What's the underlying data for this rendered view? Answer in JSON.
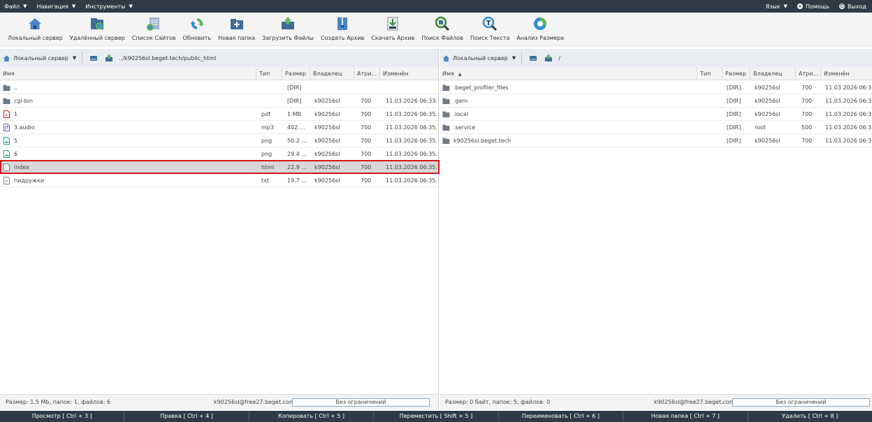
{
  "menu": {
    "file": "Файл",
    "navigation": "Навигация",
    "tools": "Инструменты",
    "language": "Язык",
    "help": "Помощь",
    "logout": "Выход"
  },
  "toolbar": [
    {
      "label": "Локальный сервер",
      "icon": "home-icon"
    },
    {
      "label": "Удалённый сервер",
      "icon": "remote-server-icon"
    },
    {
      "label": "Список Сайтов",
      "icon": "sites-list-icon"
    },
    {
      "label": "Обновить",
      "icon": "refresh-icon"
    },
    {
      "label": "Новая папка",
      "icon": "new-folder-icon"
    },
    {
      "label": "Загрузить Файлы",
      "icon": "upload-icon"
    },
    {
      "label": "Создать Архив",
      "icon": "create-archive-icon"
    },
    {
      "label": "Скачать Архив",
      "icon": "download-archive-icon"
    },
    {
      "label": "Поиск Файлов",
      "icon": "file-search-icon"
    },
    {
      "label": "Поиск Текста",
      "icon": "text-search-icon"
    },
    {
      "label": "Анализ Размера",
      "icon": "size-analysis-icon"
    }
  ],
  "left": {
    "server": "Локальный сервер",
    "path": "../k90256sl.beget.tech/public_html",
    "columns": {
      "name": "Имя",
      "type": "Тип",
      "size": "Размер",
      "owner": "Владелец",
      "attr": "Атри...",
      "modified": "Изменён"
    },
    "rows": [
      {
        "name": "..",
        "type": "",
        "size": "[DIR]",
        "owner": "",
        "attr": "",
        "modified": "",
        "icon": "folder-icon"
      },
      {
        "name": "cgi-bin",
        "type": "",
        "size": "[DIR]",
        "owner": "k90256sl",
        "attr": "700",
        "modified": "11.03.2026 06:33...",
        "icon": "folder-icon"
      },
      {
        "name": "1",
        "type": "pdf",
        "size": "1 MB",
        "owner": "k90256sl",
        "attr": "700",
        "modified": "11.03.2026 06:35...",
        "icon": "pdf-file-icon"
      },
      {
        "name": "3.audio",
        "type": "mp3",
        "size": "402....",
        "owner": "k90256sl",
        "attr": "700",
        "modified": "11.03.2026 06:35...",
        "icon": "audio-file-icon"
      },
      {
        "name": "5",
        "type": "png",
        "size": "50.2 ...",
        "owner": "k90256sl",
        "attr": "700",
        "modified": "11.03.2026 06:35...",
        "icon": "image-file-icon"
      },
      {
        "name": "6",
        "type": "png",
        "size": "29.4 ...",
        "owner": "k90256sl",
        "attr": "700",
        "modified": "11.03.2026 06:35...",
        "icon": "image-file-icon"
      },
      {
        "name": "index",
        "type": "html",
        "size": "22.9 ...",
        "owner": "k90256sl",
        "attr": "700",
        "modified": "11.03.2026 06:35...",
        "icon": "html-file-icon"
      },
      {
        "name": "пидружки",
        "type": "txt",
        "size": "19.7 ...",
        "owner": "k90256sl",
        "attr": "700",
        "modified": "11.03.2026 06:35...",
        "icon": "text-file-icon"
      }
    ],
    "status": "Размер: 1.5 Mb, папок: 1, файлов: 6",
    "user": "k90256sl@free27.beget.com",
    "limit": "Без ограничений"
  },
  "right": {
    "server": "Локальный сервер",
    "path": "/",
    "columns": {
      "name": "Имя",
      "type": "Тип",
      "size": "Размер",
      "owner": "Владелец",
      "attr": "Атри...",
      "modified": "Изменён"
    },
    "rows": [
      {
        "name": ".beget_profiler_files",
        "type": "",
        "size": "[DIR]",
        "owner": "k90256sl",
        "attr": "700",
        "modified": "11.03.2026 06:33...",
        "icon": "folder-icon"
      },
      {
        "name": ".gem",
        "type": "",
        "size": "[DIR]",
        "owner": "k90256sl",
        "attr": "700",
        "modified": "11.03.2026 06:33...",
        "icon": "folder-icon"
      },
      {
        "name": ".local",
        "type": "",
        "size": "[DIR]",
        "owner": "k90256sl",
        "attr": "700",
        "modified": "11.03.2026 06:33...",
        "icon": "folder-icon"
      },
      {
        "name": ".service",
        "type": "",
        "size": "[DIR]",
        "owner": "root",
        "attr": "500",
        "modified": "11.03.2026 06:33...",
        "icon": "folder-icon"
      },
      {
        "name": "k90256sl.beget.tech",
        "type": "",
        "size": "[DIR]",
        "owner": "k90256sl",
        "attr": "700",
        "modified": "11.03.2026 06:33...",
        "icon": "folder-icon"
      }
    ],
    "status": "Размер: 0 байт, папок: 5, файлов: 0",
    "user": "k90256sl@free27.beget.com",
    "limit": "Без ограничений"
  },
  "fnbar": [
    "Просмотр [ Ctrl + 3 ]",
    "Правка [ Ctrl + 4 ]",
    "Копировать [ Ctrl + 5 ]",
    "Переместить [ Shift + 5 ]",
    "Переименовать [ Ctrl + 6 ]",
    "Новая папка [ Ctrl + 7 ]",
    "Удалить [ Ctrl + 8 ]"
  ]
}
